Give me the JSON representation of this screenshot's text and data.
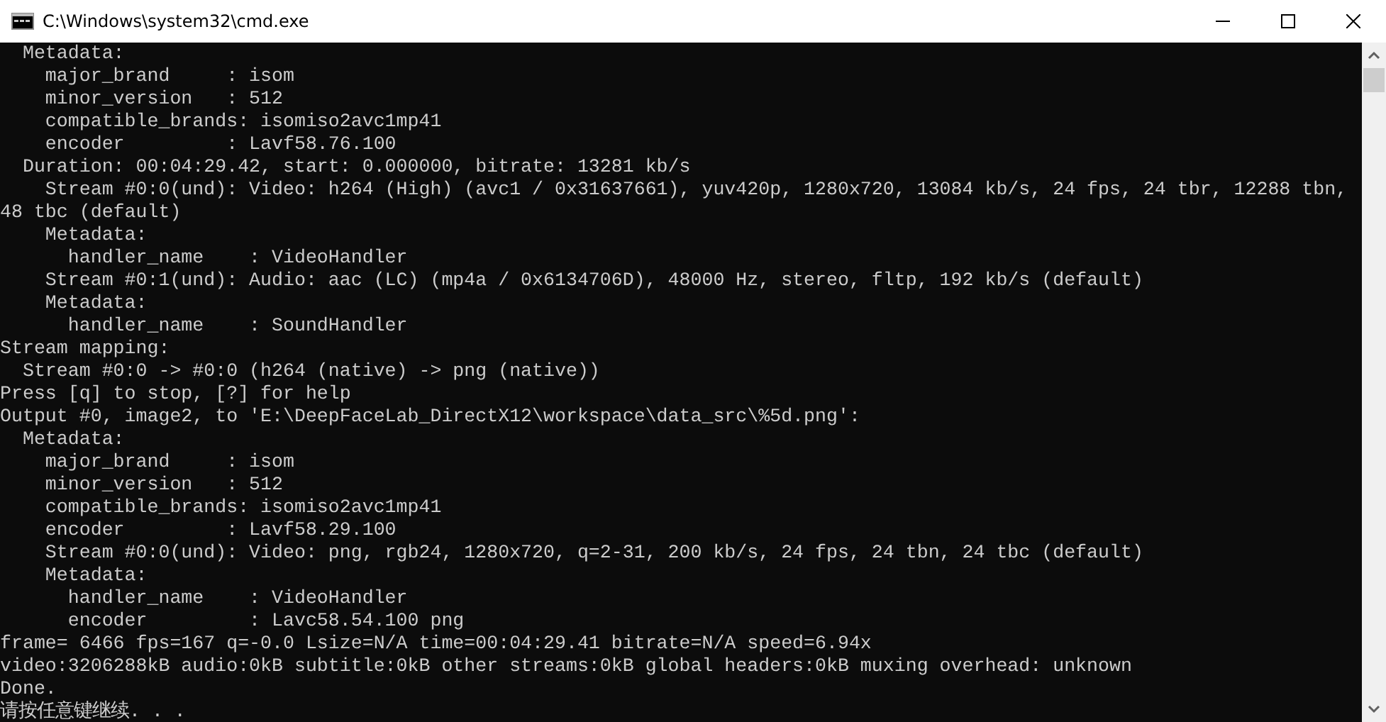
{
  "window": {
    "title": "C:\\Windows\\system32\\cmd.exe"
  },
  "console": {
    "lines": [
      "  Metadata:",
      "    major_brand     : isom",
      "    minor_version   : 512",
      "    compatible_brands: isomiso2avc1mp41",
      "    encoder         : Lavf58.76.100",
      "  Duration: 00:04:29.42, start: 0.000000, bitrate: 13281 kb/s",
      "    Stream #0:0(und): Video: h264 (High) (avc1 / 0x31637661), yuv420p, 1280x720, 13084 kb/s, 24 fps, 24 tbr, 12288 tbn,",
      "48 tbc (default)",
      "    Metadata:",
      "      handler_name    : VideoHandler",
      "    Stream #0:1(und): Audio: aac (LC) (mp4a / 0x6134706D), 48000 Hz, stereo, fltp, 192 kb/s (default)",
      "    Metadata:",
      "      handler_name    : SoundHandler",
      "Stream mapping:",
      "  Stream #0:0 -> #0:0 (h264 (native) -> png (native))",
      "Press [q] to stop, [?] for help",
      "Output #0, image2, to 'E:\\DeepFaceLab_DirectX12\\workspace\\data_src\\%5d.png':",
      "  Metadata:",
      "    major_brand     : isom",
      "    minor_version   : 512",
      "    compatible_brands: isomiso2avc1mp41",
      "    encoder         : Lavf58.29.100",
      "    Stream #0:0(und): Video: png, rgb24, 1280x720, q=2-31, 200 kb/s, 24 fps, 24 tbn, 24 tbc (default)",
      "    Metadata:",
      "      handler_name    : VideoHandler",
      "      encoder         : Lavc58.54.100 png",
      "frame= 6466 fps=167 q=-0.0 Lsize=N/A time=00:04:29.41 bitrate=N/A speed=6.94x",
      "video:3206288kB audio:0kB subtitle:0kB other streams:0kB global headers:0kB muxing overhead: unknown",
      "Done.",
      "请按任意键继续. . ."
    ]
  }
}
